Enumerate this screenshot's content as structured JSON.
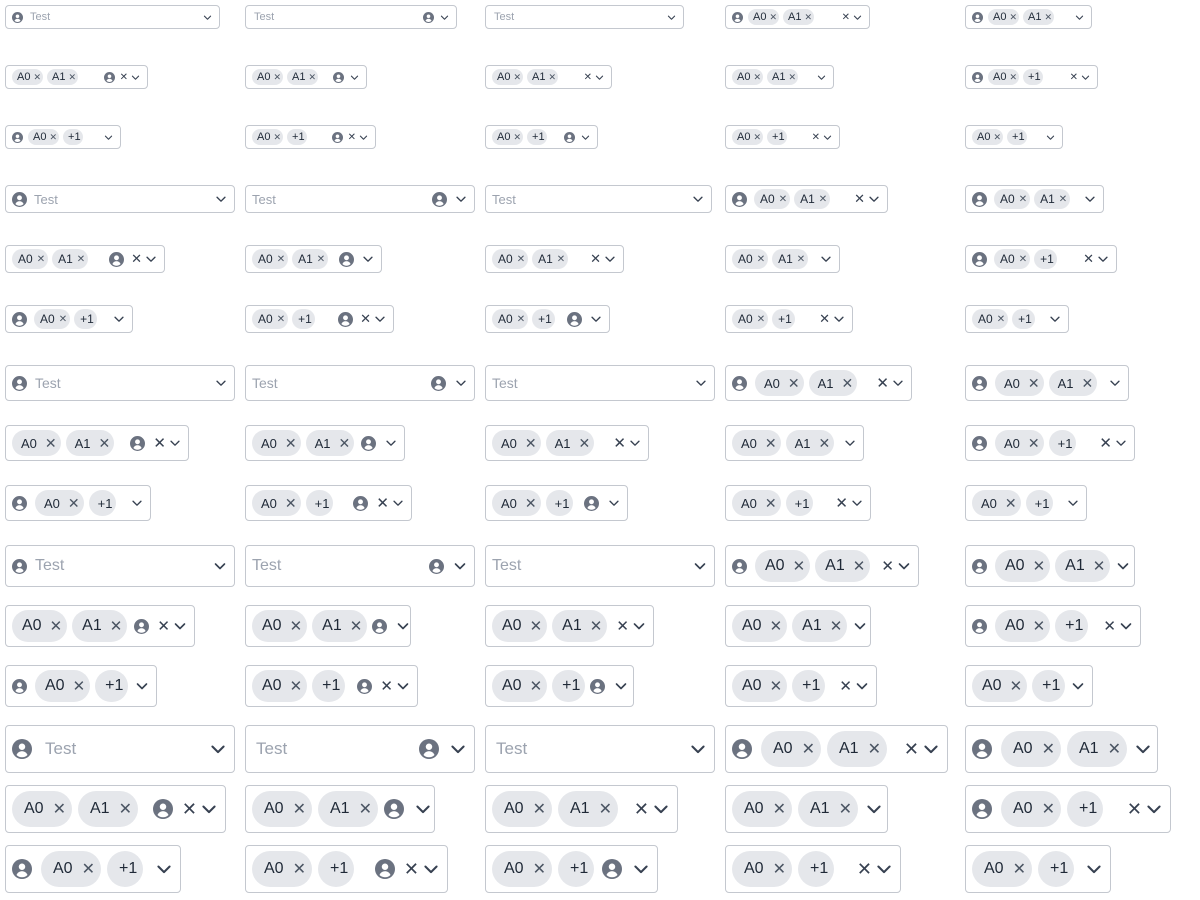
{
  "placeholder": "Test",
  "clear_glyph": "✕",
  "chevron_glyph": "⌄",
  "chip_remove_glyph": "✕",
  "icon_name": "person-icon",
  "colors": {
    "border": "#c4c8cf",
    "chip_bg": "#e5e7eb",
    "placeholder": "#9ca3af",
    "icon": "#6b7280"
  },
  "selects": [
    {
      "id": "r0c0",
      "chips": [],
      "placeholder": "Test"
    },
    {
      "id": "r0c1",
      "chips": [],
      "placeholder": "Test"
    },
    {
      "id": "r0c2",
      "chips": [],
      "placeholder": "Test"
    },
    {
      "id": "r0c3",
      "chips": [
        "A0",
        "A1"
      ]
    },
    {
      "id": "r0c4",
      "chips": [
        "A0",
        "A1"
      ]
    },
    {
      "id": "r1c0",
      "chips": [
        "A0",
        "A1"
      ]
    },
    {
      "id": "r1c1",
      "chips": [
        "A0",
        "A1"
      ]
    },
    {
      "id": "r1c2",
      "chips": [
        "A0",
        "A1"
      ]
    },
    {
      "id": "r1c3",
      "chips": [
        "A0",
        "A1"
      ]
    },
    {
      "id": "r1c4",
      "chips": [
        "A0",
        "+1"
      ]
    },
    {
      "id": "r2c0",
      "chips": [
        "A0",
        "+1"
      ]
    },
    {
      "id": "r2c1",
      "chips": [
        "A0",
        "+1"
      ]
    },
    {
      "id": "r2c2",
      "chips": [
        "A0",
        "+1"
      ]
    },
    {
      "id": "r2c3",
      "chips": [
        "A0",
        "+1"
      ]
    },
    {
      "id": "r2c4",
      "chips": [
        "A0",
        "+1"
      ]
    },
    {
      "id": "r3c0",
      "chips": [],
      "placeholder": "Test"
    },
    {
      "id": "r3c1",
      "chips": [],
      "placeholder": "Test"
    },
    {
      "id": "r3c2",
      "chips": [],
      "placeholder": "Test"
    },
    {
      "id": "r3c3",
      "chips": [
        "A0",
        "A1"
      ]
    },
    {
      "id": "r3c4",
      "chips": [
        "A0",
        "A1"
      ]
    },
    {
      "id": "r4c0",
      "chips": [
        "A0",
        "A1"
      ]
    },
    {
      "id": "r4c1",
      "chips": [
        "A0",
        "A1"
      ]
    },
    {
      "id": "r4c2",
      "chips": [
        "A0",
        "A1"
      ]
    },
    {
      "id": "r4c3",
      "chips": [
        "A0",
        "A1"
      ]
    },
    {
      "id": "r4c4",
      "chips": [
        "A0",
        "+1"
      ]
    },
    {
      "id": "r5c0",
      "chips": [
        "A0",
        "+1"
      ]
    },
    {
      "id": "r5c1",
      "chips": [
        "A0",
        "+1"
      ]
    },
    {
      "id": "r5c2",
      "chips": [
        "A0",
        "+1"
      ]
    },
    {
      "id": "r5c3",
      "chips": [
        "A0",
        "+1"
      ]
    },
    {
      "id": "r5c4",
      "chips": [
        "A0",
        "+1"
      ]
    },
    {
      "id": "r6c0",
      "chips": [],
      "placeholder": "Test"
    },
    {
      "id": "r6c1",
      "chips": [],
      "placeholder": "Test"
    },
    {
      "id": "r6c2",
      "chips": [],
      "placeholder": "Test"
    },
    {
      "id": "r6c3",
      "chips": [
        "A0",
        "A1"
      ]
    },
    {
      "id": "r6c4",
      "chips": [
        "A0",
        "A1"
      ]
    },
    {
      "id": "r7c0",
      "chips": [
        "A0",
        "A1"
      ]
    },
    {
      "id": "r7c1",
      "chips": [
        "A0",
        "A1"
      ]
    },
    {
      "id": "r7c2",
      "chips": [
        "A0",
        "A1"
      ]
    },
    {
      "id": "r7c3",
      "chips": [
        "A0",
        "A1"
      ]
    },
    {
      "id": "r7c4",
      "chips": [
        "A0",
        "+1"
      ]
    },
    {
      "id": "r8c0",
      "chips": [
        "A0",
        "+1"
      ]
    },
    {
      "id": "r8c1",
      "chips": [
        "A0",
        "+1"
      ]
    },
    {
      "id": "r8c2",
      "chips": [
        "A0",
        "+1"
      ]
    },
    {
      "id": "r8c3",
      "chips": [
        "A0",
        "+1"
      ]
    },
    {
      "id": "r8c4",
      "chips": [
        "A0",
        "+1"
      ]
    },
    {
      "id": "r9c0",
      "chips": [],
      "placeholder": "Test"
    },
    {
      "id": "r9c1",
      "chips": [],
      "placeholder": "Test"
    },
    {
      "id": "r9c2",
      "chips": [],
      "placeholder": "Test"
    },
    {
      "id": "r9c3",
      "chips": [
        "A0",
        "A1"
      ]
    },
    {
      "id": "r9c4",
      "chips": [
        "A0",
        "A1"
      ]
    },
    {
      "id": "r10c0",
      "chips": [
        "A0",
        "A1"
      ]
    },
    {
      "id": "r10c1",
      "chips": [
        "A0",
        "A1"
      ]
    },
    {
      "id": "r10c2",
      "chips": [
        "A0",
        "A1"
      ]
    },
    {
      "id": "r10c3",
      "chips": [
        "A0",
        "A1"
      ]
    },
    {
      "id": "r10c4",
      "chips": [
        "A0",
        "+1"
      ]
    },
    {
      "id": "r11c0",
      "chips": [
        "A0",
        "+1"
      ]
    },
    {
      "id": "r11c1",
      "chips": [
        "A0",
        "+1"
      ]
    },
    {
      "id": "r11c2",
      "chips": [
        "A0",
        "+1"
      ]
    },
    {
      "id": "r11c3",
      "chips": [
        "A0",
        "+1"
      ]
    },
    {
      "id": "r11c4",
      "chips": [
        "A0",
        "+1"
      ]
    },
    {
      "id": "r12c0",
      "chips": [],
      "placeholder": "Test"
    },
    {
      "id": "r12c1",
      "chips": [],
      "placeholder": "Test"
    },
    {
      "id": "r12c2",
      "chips": [],
      "placeholder": "Test"
    },
    {
      "id": "r12c3",
      "chips": [
        "A0",
        "A1"
      ]
    },
    {
      "id": "r12c4",
      "chips": [
        "A0",
        "A1"
      ]
    },
    {
      "id": "r13c0",
      "chips": [
        "A0",
        "A1"
      ]
    },
    {
      "id": "r13c1",
      "chips": [
        "A0",
        "A1"
      ]
    },
    {
      "id": "r13c2",
      "chips": [
        "A0",
        "A1"
      ]
    },
    {
      "id": "r13c3",
      "chips": [
        "A0",
        "A1"
      ]
    },
    {
      "id": "r13c4",
      "chips": [
        "A0",
        "+1"
      ]
    },
    {
      "id": "r14c0",
      "chips": [
        "A0",
        "+1"
      ]
    },
    {
      "id": "r14c1",
      "chips": [
        "A0",
        "+1"
      ]
    },
    {
      "id": "r14c2",
      "chips": [
        "A0",
        "+1"
      ]
    },
    {
      "id": "r14c3",
      "chips": [
        "A0",
        "+1"
      ]
    },
    {
      "id": "r14c4",
      "chips": [
        "A0",
        "+1"
      ]
    }
  ]
}
